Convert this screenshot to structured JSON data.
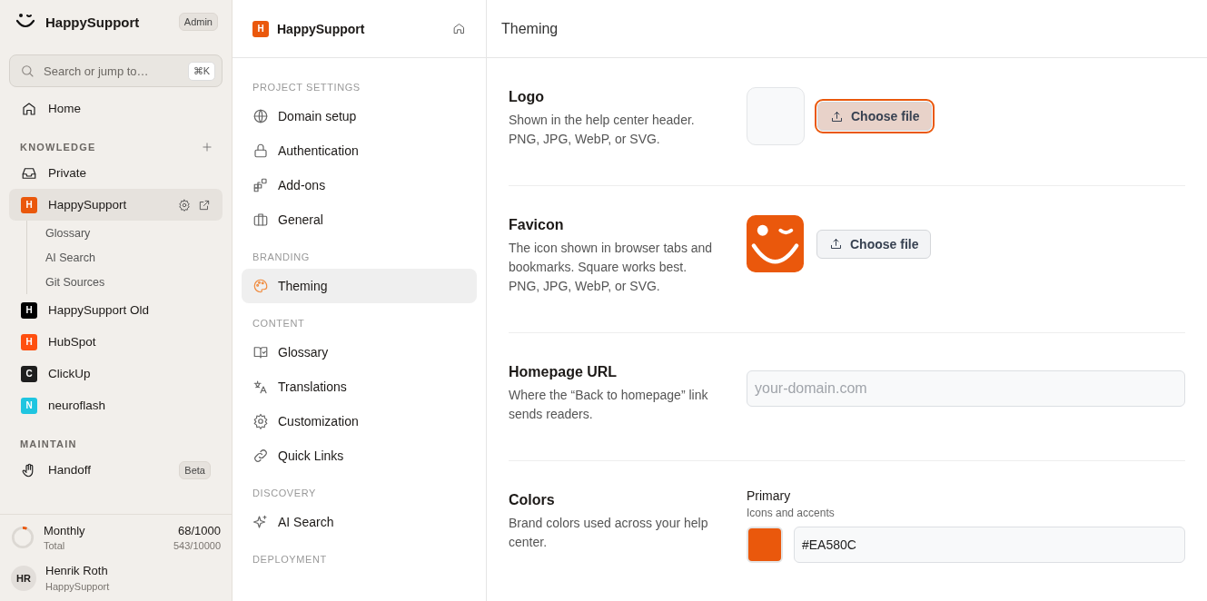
{
  "sidebar": {
    "brand": "HappySupport",
    "role_badge": "Admin",
    "search": {
      "placeholder": "Search or jump to…",
      "shortcut": "⌘K"
    },
    "home": {
      "label": "Home",
      "kind": "home"
    },
    "sections": [
      {
        "title": "KNOWLEDGE",
        "addable": true,
        "items": [
          {
            "kind": "inbox",
            "label": "Private",
            "selected": false
          },
          {
            "kind": "workspace",
            "letter": "H",
            "color": "#ea580c",
            "label": "HappySupport",
            "selected": true,
            "children": [
              {
                "label": "Glossary"
              },
              {
                "label": "AI Search"
              },
              {
                "label": "Git Sources"
              }
            ]
          },
          {
            "kind": "workspace",
            "letter": "H",
            "color": "#000000",
            "label": "HappySupport Old",
            "selected": false
          },
          {
            "kind": "workspace",
            "letter": "H",
            "color": "#ff4f0f",
            "label": "HubSpot",
            "selected": false
          },
          {
            "kind": "workspace",
            "letter": "C",
            "color": "#1e1e1e",
            "label": "ClickUp",
            "selected": false
          },
          {
            "kind": "workspace",
            "letter": "N",
            "color": "#1fc5e0",
            "label": "neuroflash",
            "selected": false
          }
        ]
      },
      {
        "title": "MAINTAIN",
        "addable": false,
        "items": [
          {
            "kind": "hand",
            "label": "Handoff",
            "badge": "Beta",
            "selected": false
          }
        ]
      }
    ],
    "usage": {
      "label": "Monthly",
      "value": "68/1000",
      "sublabel": "Total",
      "subvalue": "543/10000",
      "level": 0.068
    },
    "user": {
      "initials": "HR",
      "name": "Henrik Roth",
      "org": "HappySupport"
    }
  },
  "settings_nav": {
    "project": {
      "letter": "H",
      "name": "HappySupport"
    },
    "groups": [
      {
        "title": "PROJECT SETTINGS",
        "items": [
          {
            "kind": "globe",
            "label": "Domain setup",
            "selected": false
          },
          {
            "kind": "lock",
            "label": "Authentication",
            "selected": false
          },
          {
            "kind": "addons",
            "label": "Add-ons",
            "selected": false
          },
          {
            "kind": "briefcase",
            "label": "General",
            "selected": false
          }
        ]
      },
      {
        "title": "BRANDING",
        "items": [
          {
            "kind": "palette",
            "label": "Theming",
            "selected": true
          }
        ]
      },
      {
        "title": "CONTENT",
        "items": [
          {
            "kind": "book",
            "label": "Glossary",
            "selected": false
          },
          {
            "kind": "translate",
            "label": "Translations",
            "selected": false
          },
          {
            "kind": "gear",
            "label": "Customization",
            "selected": false
          },
          {
            "kind": "link",
            "label": "Quick Links",
            "selected": false
          }
        ]
      },
      {
        "title": "DISCOVERY",
        "items": [
          {
            "kind": "sparkle",
            "label": "AI Search",
            "selected": false
          }
        ]
      },
      {
        "title": "DEPLOYMENT"
      }
    ]
  },
  "page": {
    "title": "Theming",
    "sections": [
      {
        "kind": "upload",
        "title": "Logo",
        "description": "Shown in the help center header. PNG, JPG, WebP, or SVG.",
        "image_set": false,
        "button": "Choose file",
        "focused": true
      },
      {
        "kind": "upload",
        "title": "Favicon",
        "description": "The icon shown in browser tabs and bookmarks. Square works best. PNG, JPG, WebP, or SVG.",
        "image_set": true,
        "button": "Choose file",
        "focused": false
      },
      {
        "kind": "text",
        "title": "Homepage URL",
        "description": "Where the “Back to homepage” link sends readers.",
        "placeholder": "your-domain.com"
      },
      {
        "kind": "color",
        "title": "Colors",
        "description": "Brand colors used across your help center.",
        "label": "Primary",
        "hint": "Icons and accents",
        "value": "#EA580C",
        "color": "#ea580c"
      }
    ]
  }
}
